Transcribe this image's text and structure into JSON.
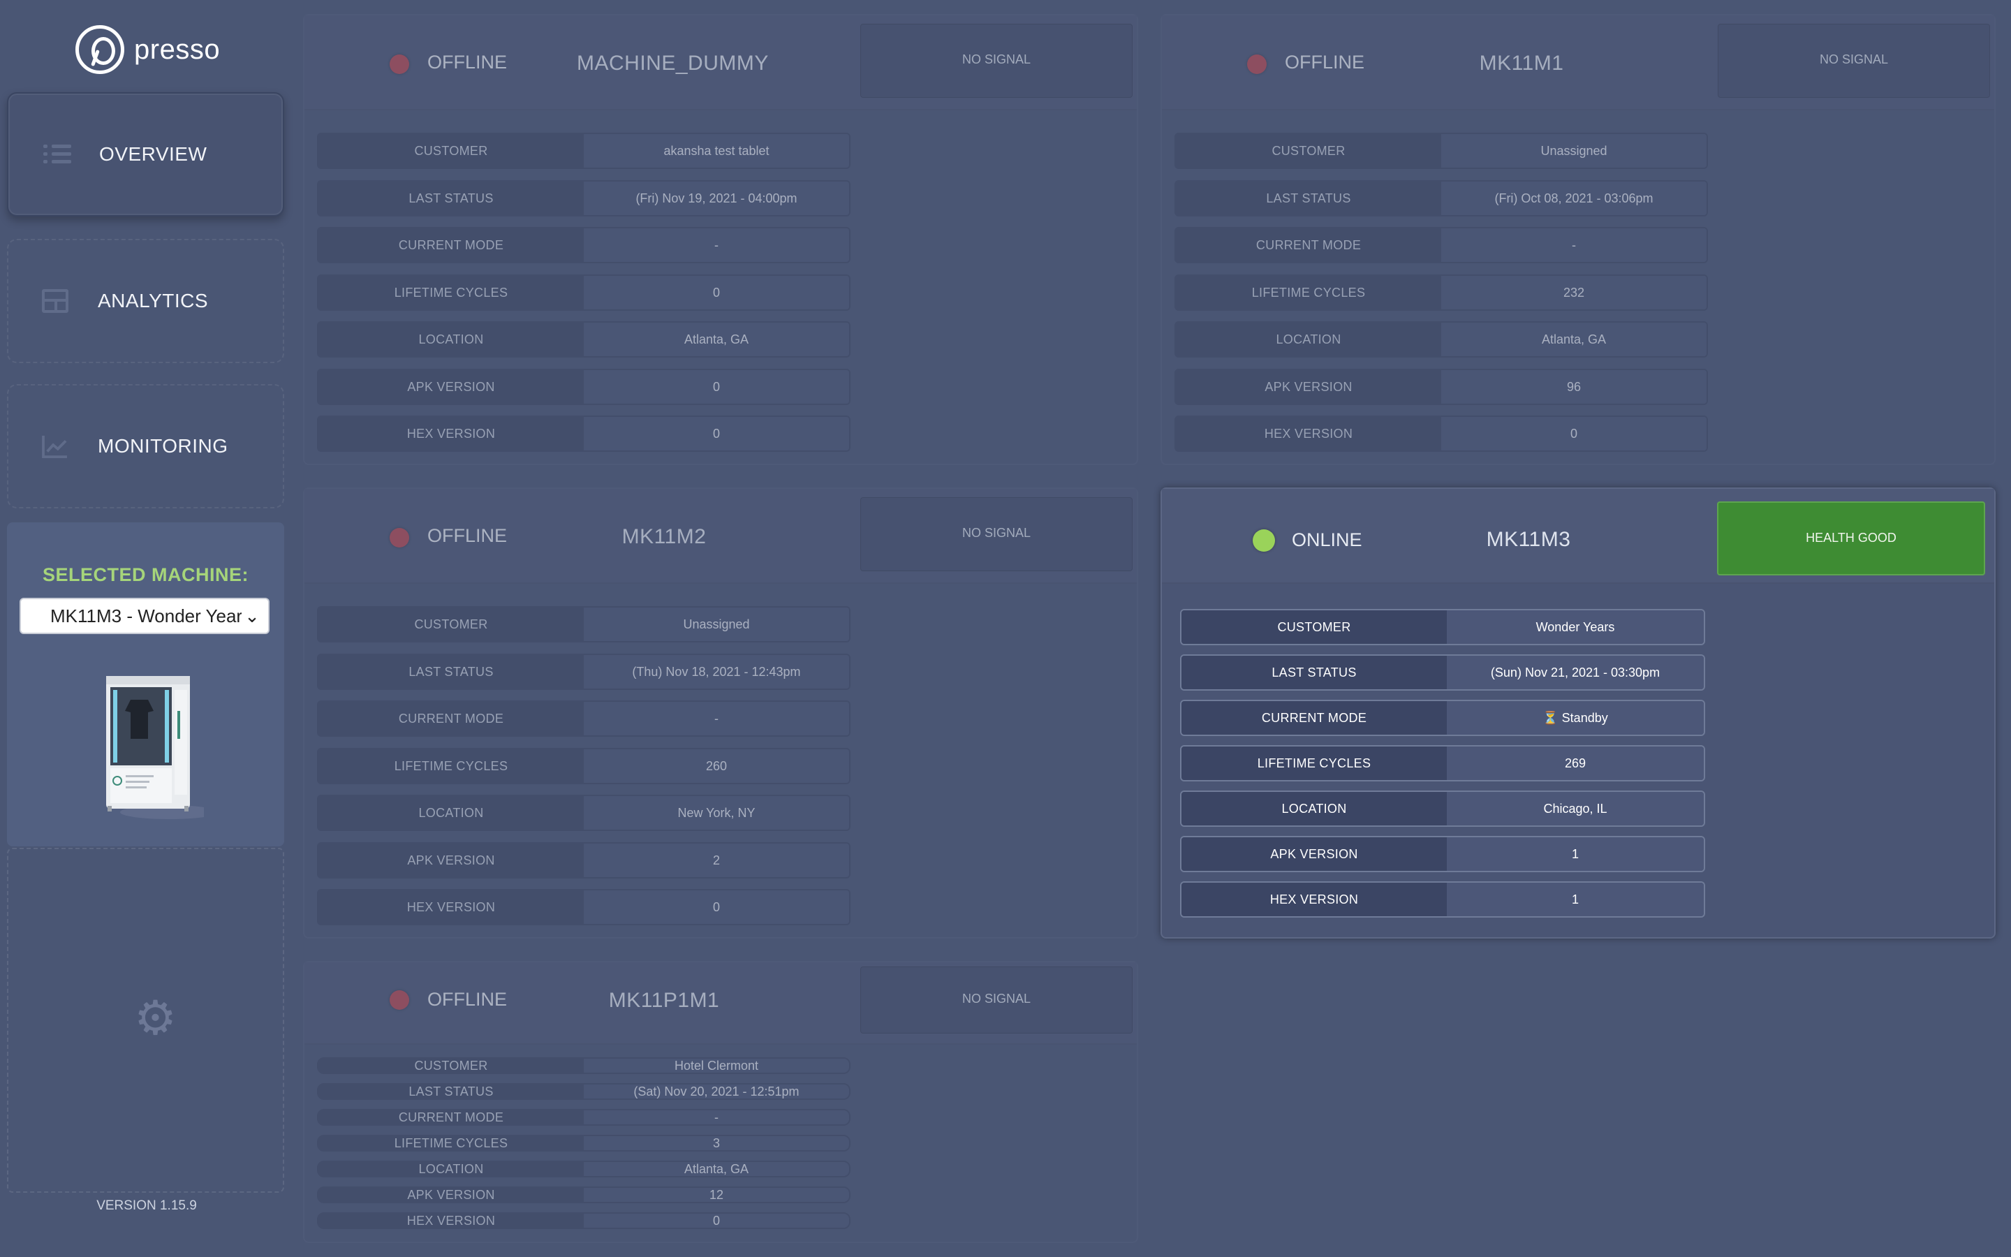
{
  "app": {
    "logo_text": "presso",
    "version": "VERSION 1.15.9"
  },
  "nav": [
    {
      "label": "OVERVIEW",
      "icon": "list-icon",
      "active": true
    },
    {
      "label": "ANALYTICS",
      "icon": "grid-icon",
      "active": false
    },
    {
      "label": "MONITORING",
      "icon": "chart-icon",
      "active": false
    }
  ],
  "selected_machine": {
    "title": "SELECTED MACHINE:",
    "value": "MK11M3 - Wonder Years"
  },
  "labels": [
    "CUSTOMER",
    "LAST STATUS",
    "CURRENT MODE",
    "LIFETIME CYCLES",
    "LOCATION",
    "APK VERSION",
    "HEX VERSION"
  ],
  "machines": [
    {
      "status": "OFFLINE",
      "name": "MACHINE_DUMMY",
      "signal": "NO SIGNAL",
      "values": [
        "akansha test tablet",
        "(Fri) Nov 19, 2021 - 04:00pm",
        "-",
        "0",
        "Atlanta, GA",
        "0",
        "0"
      ]
    },
    {
      "status": "OFFLINE",
      "name": "MK11M1",
      "signal": "NO SIGNAL",
      "values": [
        "Unassigned",
        "(Fri) Oct 08, 2021 - 03:06pm",
        "-",
        "232",
        "Atlanta, GA",
        "96",
        "0"
      ]
    },
    {
      "status": "OFFLINE",
      "name": "MK11M2",
      "signal": "NO SIGNAL",
      "values": [
        "Unassigned",
        "(Thu) Nov 18, 2021 - 12:43pm",
        "-",
        "260",
        "New York, NY",
        "2",
        "0"
      ]
    },
    {
      "status": "ONLINE",
      "name": "MK11M3",
      "signal": "HEALTH GOOD",
      "values": [
        "Wonder Years",
        "(Sun) Nov 21, 2021 - 03:30pm",
        "⏳ Standby",
        "269",
        "Chicago, IL",
        "1",
        "1"
      ]
    },
    {
      "status": "OFFLINE",
      "name": "MK11P1M1",
      "signal": "NO SIGNAL",
      "values": [
        "Hotel Clermont",
        "(Sat) Nov 20, 2021 - 12:51pm",
        "-",
        "3",
        "Atlanta, GA",
        "12",
        "0"
      ]
    }
  ]
}
